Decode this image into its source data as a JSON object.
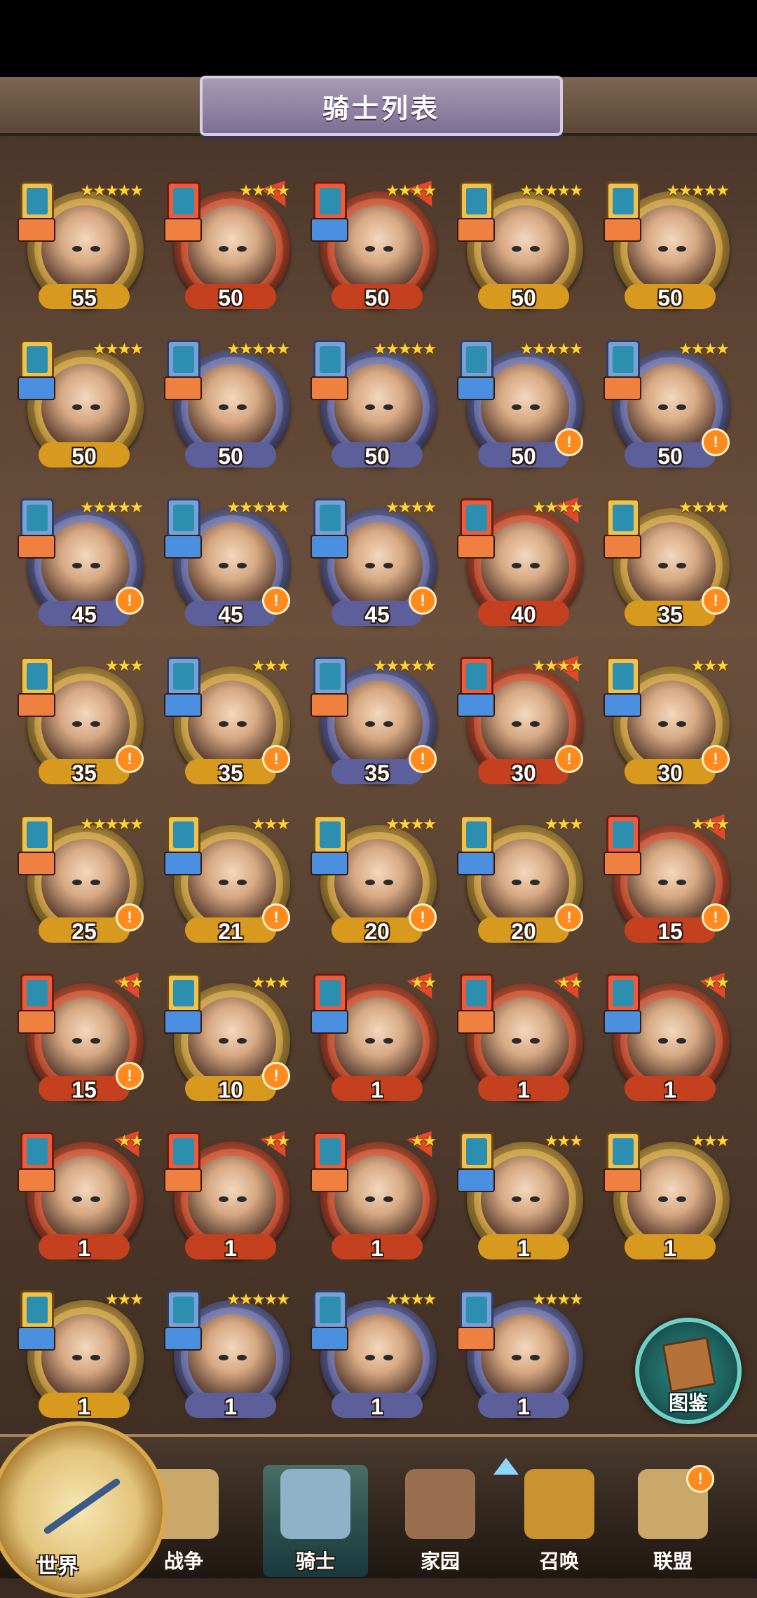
{
  "header": {
    "title": "骑士列表"
  },
  "knights": [
    {
      "level": "55",
      "stars": "★★★★★",
      "ring": "gold",
      "badge": "gold",
      "type": "orange",
      "arrow": false,
      "alert": false
    },
    {
      "level": "50",
      "stars": "★★★★",
      "ring": "red",
      "badge": "red",
      "type": "orange",
      "arrow": true,
      "alert": false
    },
    {
      "level": "50",
      "stars": "★★★★",
      "ring": "red",
      "badge": "red",
      "type": "blue",
      "arrow": true,
      "alert": false
    },
    {
      "level": "50",
      "stars": "★★★★★",
      "ring": "gold",
      "badge": "gold",
      "type": "orange",
      "arrow": false,
      "alert": false
    },
    {
      "level": "50",
      "stars": "★★★★★",
      "ring": "gold",
      "badge": "gold",
      "type": "orange",
      "arrow": false,
      "alert": false
    },
    {
      "level": "50",
      "stars": "★★★★",
      "ring": "gold",
      "badge": "gold",
      "type": "blue",
      "arrow": false,
      "alert": false
    },
    {
      "level": "50",
      "stars": "★★★★★",
      "ring": "purple",
      "badge": "blue",
      "type": "orange",
      "arrow": false,
      "alert": false
    },
    {
      "level": "50",
      "stars": "★★★★★",
      "ring": "purple",
      "badge": "blue",
      "type": "orange",
      "arrow": false,
      "alert": false
    },
    {
      "level": "50",
      "stars": "★★★★★",
      "ring": "purple",
      "badge": "blue",
      "type": "blue",
      "arrow": false,
      "alert": true
    },
    {
      "level": "50",
      "stars": "★★★★",
      "ring": "purple",
      "badge": "blue",
      "type": "orange",
      "arrow": false,
      "alert": true
    },
    {
      "level": "45",
      "stars": "★★★★★",
      "ring": "purple",
      "badge": "blue",
      "type": "orange",
      "arrow": false,
      "alert": true
    },
    {
      "level": "45",
      "stars": "★★★★★",
      "ring": "purple",
      "badge": "blue",
      "type": "blue",
      "arrow": false,
      "alert": true
    },
    {
      "level": "45",
      "stars": "★★★★",
      "ring": "purple",
      "badge": "blue",
      "type": "blue",
      "arrow": false,
      "alert": true
    },
    {
      "level": "40",
      "stars": "★★★★",
      "ring": "red",
      "badge": "red",
      "type": "orange",
      "arrow": true,
      "alert": false
    },
    {
      "level": "35",
      "stars": "★★★★",
      "ring": "gold",
      "badge": "gold",
      "type": "orange",
      "arrow": false,
      "alert": true
    },
    {
      "level": "35",
      "stars": "★★★",
      "ring": "gold",
      "badge": "gold",
      "type": "orange",
      "arrow": false,
      "alert": true
    },
    {
      "level": "35",
      "stars": "★★★",
      "ring": "gold",
      "badge": "blue",
      "type": "blue",
      "arrow": false,
      "alert": true
    },
    {
      "level": "35",
      "stars": "★★★★★",
      "ring": "purple",
      "badge": "blue",
      "type": "orange",
      "arrow": false,
      "alert": true
    },
    {
      "level": "30",
      "stars": "★★★★",
      "ring": "red",
      "badge": "red",
      "type": "blue",
      "arrow": true,
      "alert": true
    },
    {
      "level": "30",
      "stars": "★★★",
      "ring": "gold",
      "badge": "gold",
      "type": "blue",
      "arrow": false,
      "alert": true
    },
    {
      "level": "25",
      "stars": "★★★★★",
      "ring": "gold",
      "badge": "gold",
      "type": "orange",
      "arrow": false,
      "alert": true
    },
    {
      "level": "21",
      "stars": "★★★",
      "ring": "gold",
      "badge": "gold",
      "type": "blue",
      "arrow": false,
      "alert": true
    },
    {
      "level": "20",
      "stars": "★★★★",
      "ring": "gold",
      "badge": "gold",
      "type": "blue",
      "arrow": false,
      "alert": true
    },
    {
      "level": "20",
      "stars": "★★★",
      "ring": "gold",
      "badge": "gold",
      "type": "blue",
      "arrow": false,
      "alert": true
    },
    {
      "level": "15",
      "stars": "★★★",
      "ring": "red",
      "badge": "red",
      "type": "orange",
      "arrow": true,
      "alert": true
    },
    {
      "level": "15",
      "stars": "★★",
      "ring": "red",
      "badge": "red",
      "type": "orange",
      "arrow": true,
      "alert": true
    },
    {
      "level": "10",
      "stars": "★★★",
      "ring": "gold",
      "badge": "gold",
      "type": "blue",
      "arrow": false,
      "alert": true
    },
    {
      "level": "1",
      "stars": "★★",
      "ring": "red",
      "badge": "red",
      "type": "blue",
      "arrow": true,
      "alert": false
    },
    {
      "level": "1",
      "stars": "★★",
      "ring": "red",
      "badge": "red",
      "type": "orange",
      "arrow": true,
      "alert": false
    },
    {
      "level": "1",
      "stars": "★★",
      "ring": "red",
      "badge": "red",
      "type": "blue",
      "arrow": true,
      "alert": false
    },
    {
      "level": "1",
      "stars": "★★",
      "ring": "red",
      "badge": "red",
      "type": "orange",
      "arrow": true,
      "alert": false
    },
    {
      "level": "1",
      "stars": "★★",
      "ring": "red",
      "badge": "red",
      "type": "orange",
      "arrow": true,
      "alert": false
    },
    {
      "level": "1",
      "stars": "★★",
      "ring": "red",
      "badge": "red",
      "type": "orange",
      "arrow": true,
      "alert": false
    },
    {
      "level": "1",
      "stars": "★★★",
      "ring": "gold",
      "badge": "gold",
      "type": "blue",
      "arrow": false,
      "alert": false
    },
    {
      "level": "1",
      "stars": "★★★",
      "ring": "gold",
      "badge": "gold",
      "type": "orange",
      "arrow": false,
      "alert": false
    },
    {
      "level": "1",
      "stars": "★★★",
      "ring": "gold",
      "badge": "gold",
      "type": "blue",
      "arrow": false,
      "alert": false
    },
    {
      "level": "1",
      "stars": "★★★★★",
      "ring": "purple",
      "badge": "blue",
      "type": "blue",
      "arrow": false,
      "alert": false
    },
    {
      "level": "1",
      "stars": "★★★★",
      "ring": "purple",
      "badge": "blue",
      "type": "blue",
      "arrow": false,
      "alert": false
    },
    {
      "level": "1",
      "stars": "★★★★",
      "ring": "purple",
      "badge": "blue",
      "type": "orange",
      "arrow": false,
      "alert": false
    }
  ],
  "codex": {
    "label": "图鉴"
  },
  "nav": {
    "world": "世界",
    "items": [
      {
        "label": "战争",
        "icon": "war-map-icon",
        "active": false,
        "alert": false
      },
      {
        "label": "骑士",
        "icon": "knight-icon",
        "active": true,
        "alert": false
      },
      {
        "label": "家园",
        "icon": "home-icon",
        "active": false,
        "alert": false
      },
      {
        "label": "召唤",
        "icon": "summon-train-icon",
        "active": false,
        "alert": false
      },
      {
        "label": "联盟",
        "icon": "alliance-icon",
        "active": false,
        "alert": true
      }
    ],
    "alert_mark": "!"
  },
  "colors": {
    "gold": "#d79a1f",
    "red": "#c5401e",
    "purple": "#5d5f9b",
    "alert": "#ff8a1e"
  }
}
